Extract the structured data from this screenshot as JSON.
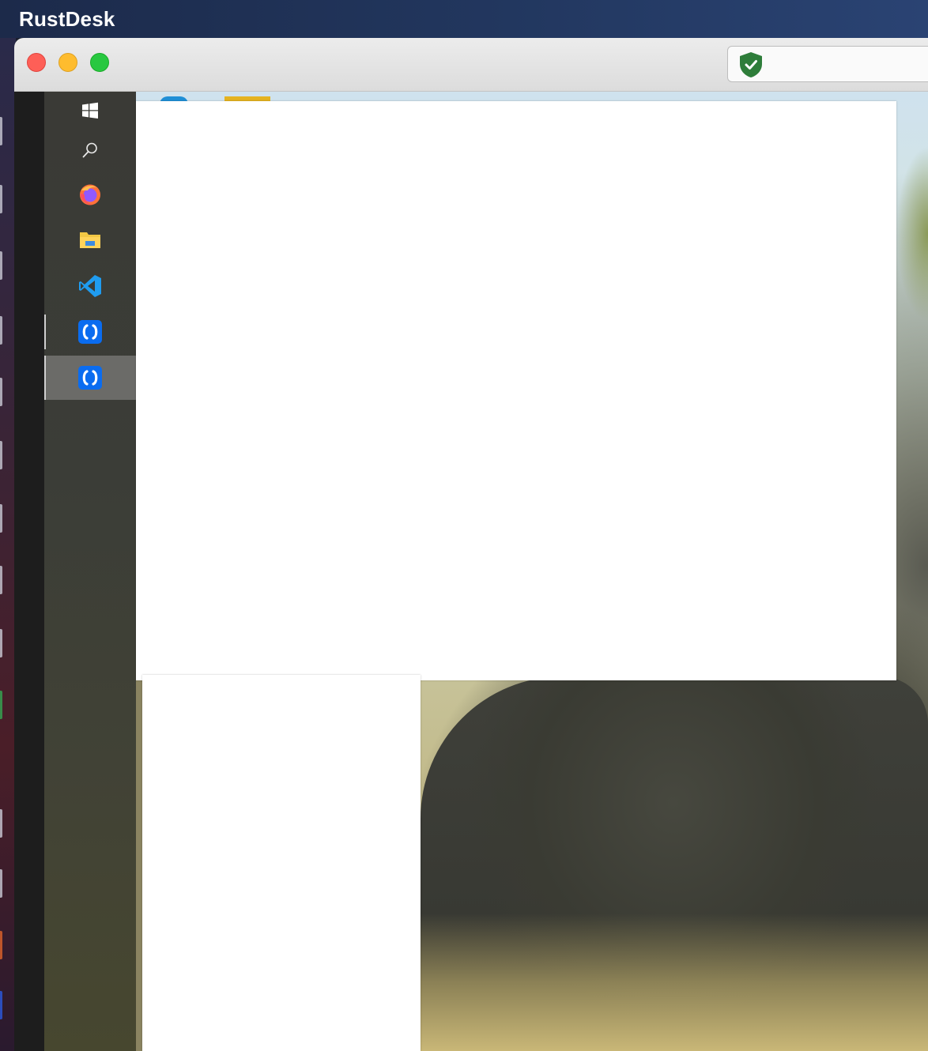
{
  "menubar": {
    "app_name": "RustDesk"
  },
  "window": {
    "traffic_lights": [
      {
        "name": "close",
        "color": "#fe5f57"
      },
      {
        "name": "minimize",
        "color": "#febc2e"
      },
      {
        "name": "maximize",
        "color": "#28c840"
      }
    ],
    "security_icon": "shield-check-icon",
    "security_color": "#2e7d3a"
  },
  "remote_taskbar": {
    "items": [
      {
        "icon": "windows-start-icon",
        "active": false
      },
      {
        "icon": "search-icon",
        "active": false
      },
      {
        "icon": "firefox-icon",
        "active": false
      },
      {
        "icon": "file-explorer-icon",
        "active": false
      },
      {
        "icon": "vscode-icon",
        "active": false
      },
      {
        "icon": "rustdesk-icon",
        "active": false,
        "running": true
      },
      {
        "icon": "rustdesk-icon",
        "active": true,
        "running": true
      }
    ]
  },
  "colors": {
    "menubar": "#22375f",
    "taskbar": "#3b3d37",
    "active_item": "#6b6b68",
    "rustdesk_blue": "#0a6cf0"
  }
}
